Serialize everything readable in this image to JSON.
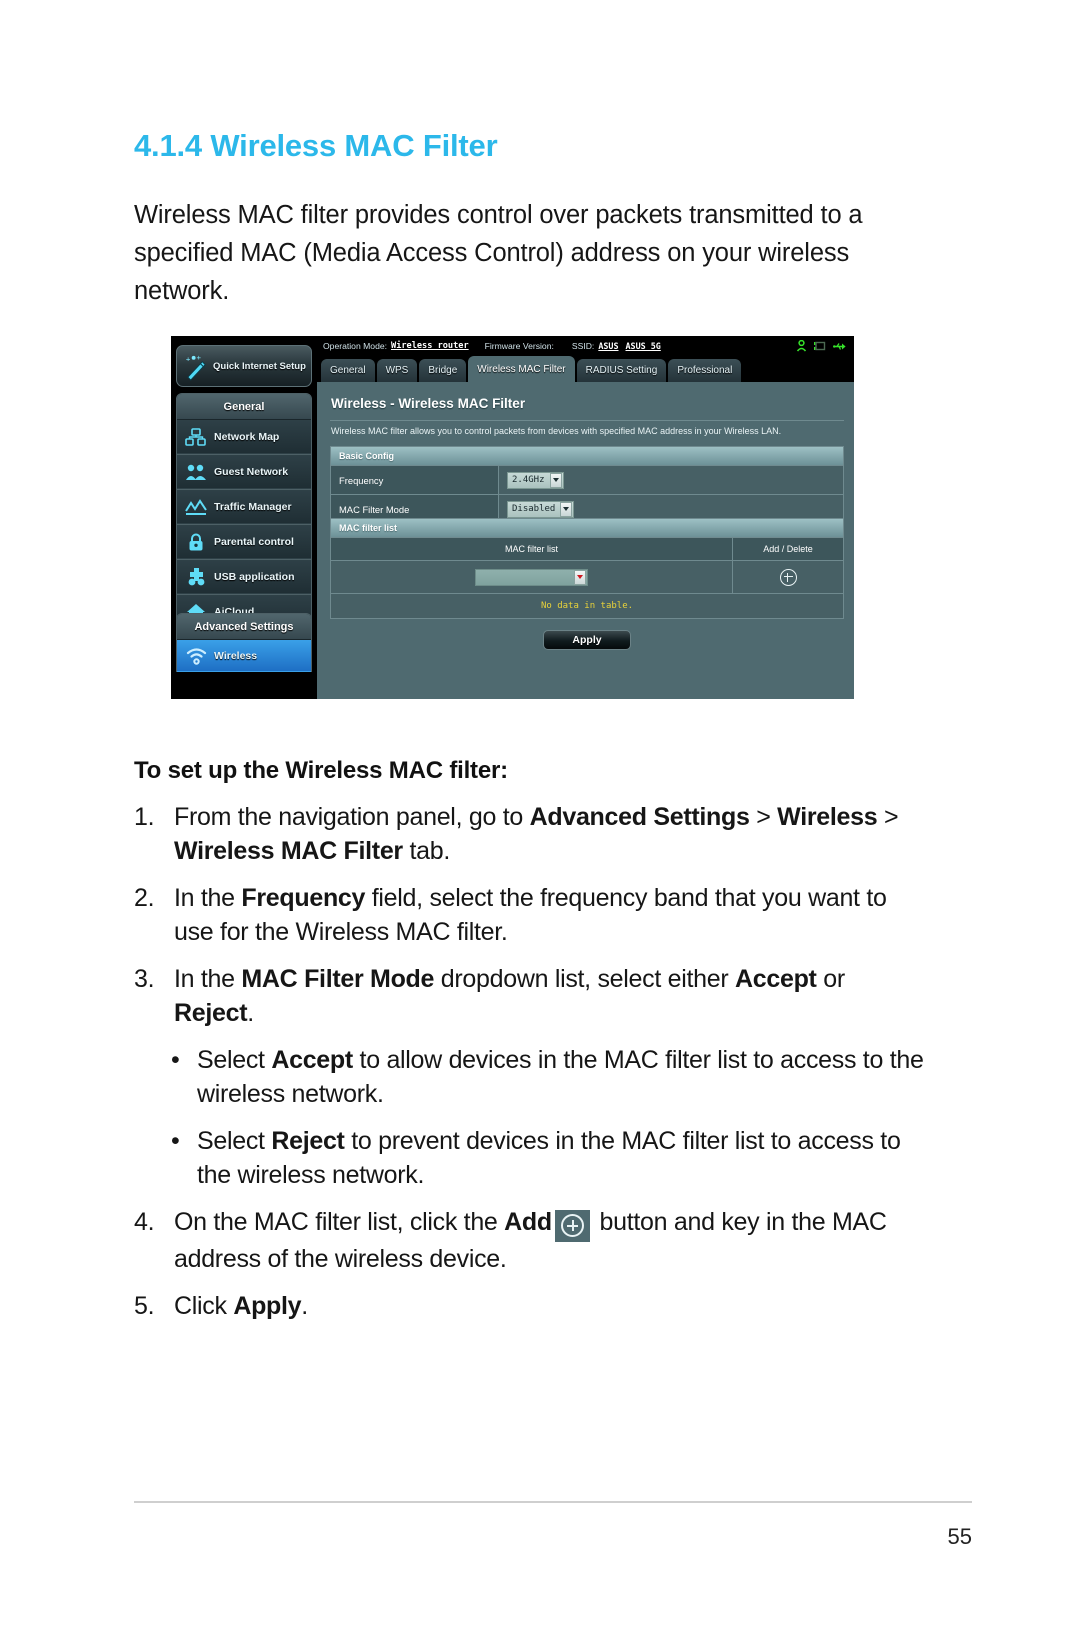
{
  "document": {
    "section_number": "4.1.4",
    "section_title": "Wireless MAC Filter",
    "intro": "Wireless MAC filter provides control over packets transmitted to a specified MAC (Media Access Control) address on your wireless network.",
    "page_number": "55"
  },
  "router_ui": {
    "status_bar": {
      "operation_mode_label": "Operation Mode:",
      "operation_mode_value": "Wireless router",
      "firmware_label": "Firmware Version:",
      "firmware_value": "",
      "ssid_label": "SSID:",
      "ssid_value_1": "ASUS",
      "ssid_value_2": "ASUS_5G",
      "icons": [
        "user-icon",
        "monitor-icon",
        "usb-icon"
      ]
    },
    "quick_internet_setup": {
      "label": "Quick Internet Setup",
      "icon": "magic-wand-icon"
    },
    "nav_general": {
      "title": "General",
      "items": [
        {
          "label": "Network Map",
          "icon": "network-map-icon"
        },
        {
          "label": "Guest Network",
          "icon": "guest-network-icon"
        },
        {
          "label": "Traffic Manager",
          "icon": "traffic-manager-icon"
        },
        {
          "label": "Parental control",
          "icon": "lock-icon"
        },
        {
          "label": "USB application",
          "icon": "usb-application-icon"
        },
        {
          "label": "AiCloud",
          "icon": "aicloud-icon"
        }
      ]
    },
    "nav_advanced": {
      "title": "Advanced Settings",
      "items": [
        {
          "label": "Wireless",
          "icon": "wifi-icon",
          "active": true
        }
      ]
    },
    "tabs": [
      {
        "label": "General",
        "active": false
      },
      {
        "label": "WPS",
        "active": false
      },
      {
        "label": "Bridge",
        "active": false
      },
      {
        "label": "Wireless MAC Filter",
        "active": true
      },
      {
        "label": "RADIUS Setting",
        "active": false
      },
      {
        "label": "Professional",
        "active": false
      }
    ],
    "panel": {
      "title": "Wireless - Wireless MAC Filter",
      "description": "Wireless MAC filter allows you to control packets from devices with specified MAC address in your Wireless LAN.",
      "basic_config": {
        "header": "Basic Config",
        "rows": [
          {
            "label": "Frequency",
            "value": "2.4GHz"
          },
          {
            "label": "MAC Filter Mode",
            "value": "Disabled"
          }
        ]
      },
      "mac_filter_list": {
        "header": "MAC filter list",
        "col_list": "MAC filter list",
        "col_add_delete": "Add / Delete",
        "input_value": "",
        "add_icon": "plus-circle-icon",
        "empty_text": "No data in table."
      },
      "apply_label": "Apply"
    }
  },
  "instructions": {
    "heading": "To set up the Wireless MAC filter:",
    "steps": [
      {
        "number": "1.",
        "parts": [
          {
            "t": "From the navigation panel, go to ",
            "b": false
          },
          {
            "t": "Advanced Settings",
            "b": true
          },
          {
            "t": " > ",
            "b": false
          },
          {
            "t": "Wireless",
            "b": true
          },
          {
            "t": " > ",
            "b": false
          },
          {
            "t": "Wireless MAC Filter",
            "b": true
          },
          {
            "t": " tab.",
            "b": false
          }
        ]
      },
      {
        "number": "2.",
        "parts": [
          {
            "t": "In the ",
            "b": false
          },
          {
            "t": "Frequency",
            "b": true
          },
          {
            "t": " field, select the frequency band that you want to use for the Wireless MAC filter.",
            "b": false
          }
        ]
      },
      {
        "number": "3.",
        "parts": [
          {
            "t": "In the ",
            "b": false
          },
          {
            "t": "MAC Filter Mode",
            "b": true
          },
          {
            "t": " dropdown list, select either ",
            "b": false
          },
          {
            "t": "Accept",
            "b": true
          },
          {
            "t": " or ",
            "b": false
          },
          {
            "t": "Reject",
            "b": true
          },
          {
            "t": ".",
            "b": false
          }
        ]
      }
    ],
    "bullets": [
      {
        "marker": "•",
        "parts": [
          {
            "t": "Select ",
            "b": false
          },
          {
            "t": "Accept",
            "b": true
          },
          {
            "t": " to allow devices in the MAC filter list to access to the wireless network.",
            "b": false
          }
        ]
      },
      {
        "marker": "•",
        "parts": [
          {
            "t": "Select ",
            "b": false
          },
          {
            "t": "Reject",
            "b": true
          },
          {
            "t": " to prevent devices in the MAC filter list to access to the wireless network.",
            "b": false
          }
        ]
      }
    ],
    "steps_after": [
      {
        "number": "4.",
        "parts": [
          {
            "t": "On the MAC filter list, click the ",
            "b": false
          },
          {
            "t": "Add",
            "b": true
          },
          {
            "t": "__ADD_ICON__",
            "b": false
          },
          {
            "t": " button and key in the MAC address of the wireless device.",
            "b": false
          }
        ]
      },
      {
        "number": "5.",
        "parts": [
          {
            "t": "Click ",
            "b": false
          },
          {
            "t": "Apply",
            "b": true
          },
          {
            "t": ".",
            "b": false
          }
        ]
      }
    ]
  },
  "colors": {
    "heading_blue": "#2cb8ea",
    "panel_teal": "#4f6a70",
    "active_nav_blue": "#2a85d6",
    "warning_yellow": "#e8d23a"
  }
}
